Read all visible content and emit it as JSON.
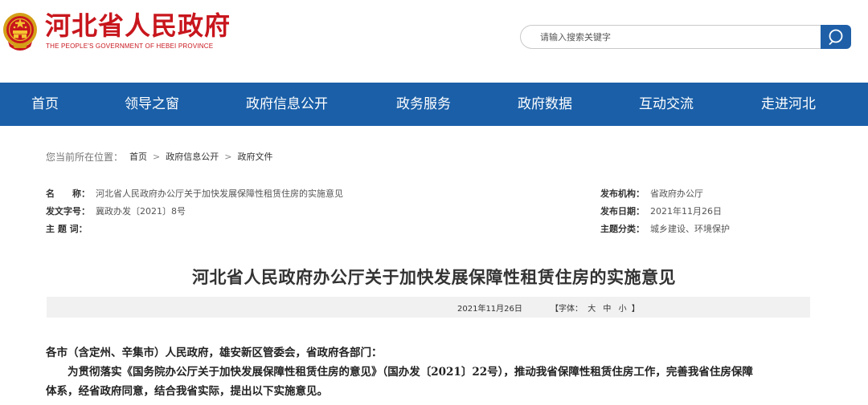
{
  "header": {
    "site_title": "河北省人民政府",
    "site_subtitle": "THE PEOPLE'S GOVERNMENT OF HEBEI PROVINCE",
    "search_placeholder": "请输入搜索关键字"
  },
  "nav": {
    "items": [
      "首页",
      "领导之窗",
      "政府信息公开",
      "政务服务",
      "政府数据",
      "互动交流",
      "走进河北"
    ]
  },
  "breadcrumb": {
    "label": "您当前所在位置：",
    "items": [
      "首页",
      "政府信息公开",
      "政府文件"
    ]
  },
  "meta": {
    "name_key": "名　　称：",
    "name_val": "河北省人民政府办公厅关于加快发展保障性租赁住房的实施意见",
    "doc_no_key": "发文字号：",
    "doc_no_val": "冀政办发〔2021〕8号",
    "subject_key": "主 题 词：",
    "subject_val": "",
    "publisher_key": "发布机构：",
    "publisher_val": "省政府办公厅",
    "date_key": "发布日期：",
    "date_val": "2021年11月26日",
    "category_key": "主题分类：",
    "category_val": "城乡建设、环境保护"
  },
  "article": {
    "title": "河北省人民政府办公厅关于加快发展保障性租赁住房的实施意见",
    "date": "2021年11月26日",
    "font_label_open": "【字体：",
    "font_large": "大",
    "font_medium": "中",
    "font_small": "小",
    "font_label_close": "】",
    "salutation": "各市（含定州、辛集市）人民政府，雄安新区管委会，省政府各部门：",
    "para1_line1": "为贯彻落实《国务院办公厅关于加快发展保障性租赁住房的意见》（国办发〔2021〕22号），推动我省保障性租赁住房工作，完善我省住房保障",
    "para1_line2": "体系，经省政府同意，结合我省实际，提出以下实施意见。"
  },
  "colors": {
    "brand_red": "#c8161d",
    "nav_blue": "#1a5fa8",
    "search_blue": "#1e5fa8"
  }
}
